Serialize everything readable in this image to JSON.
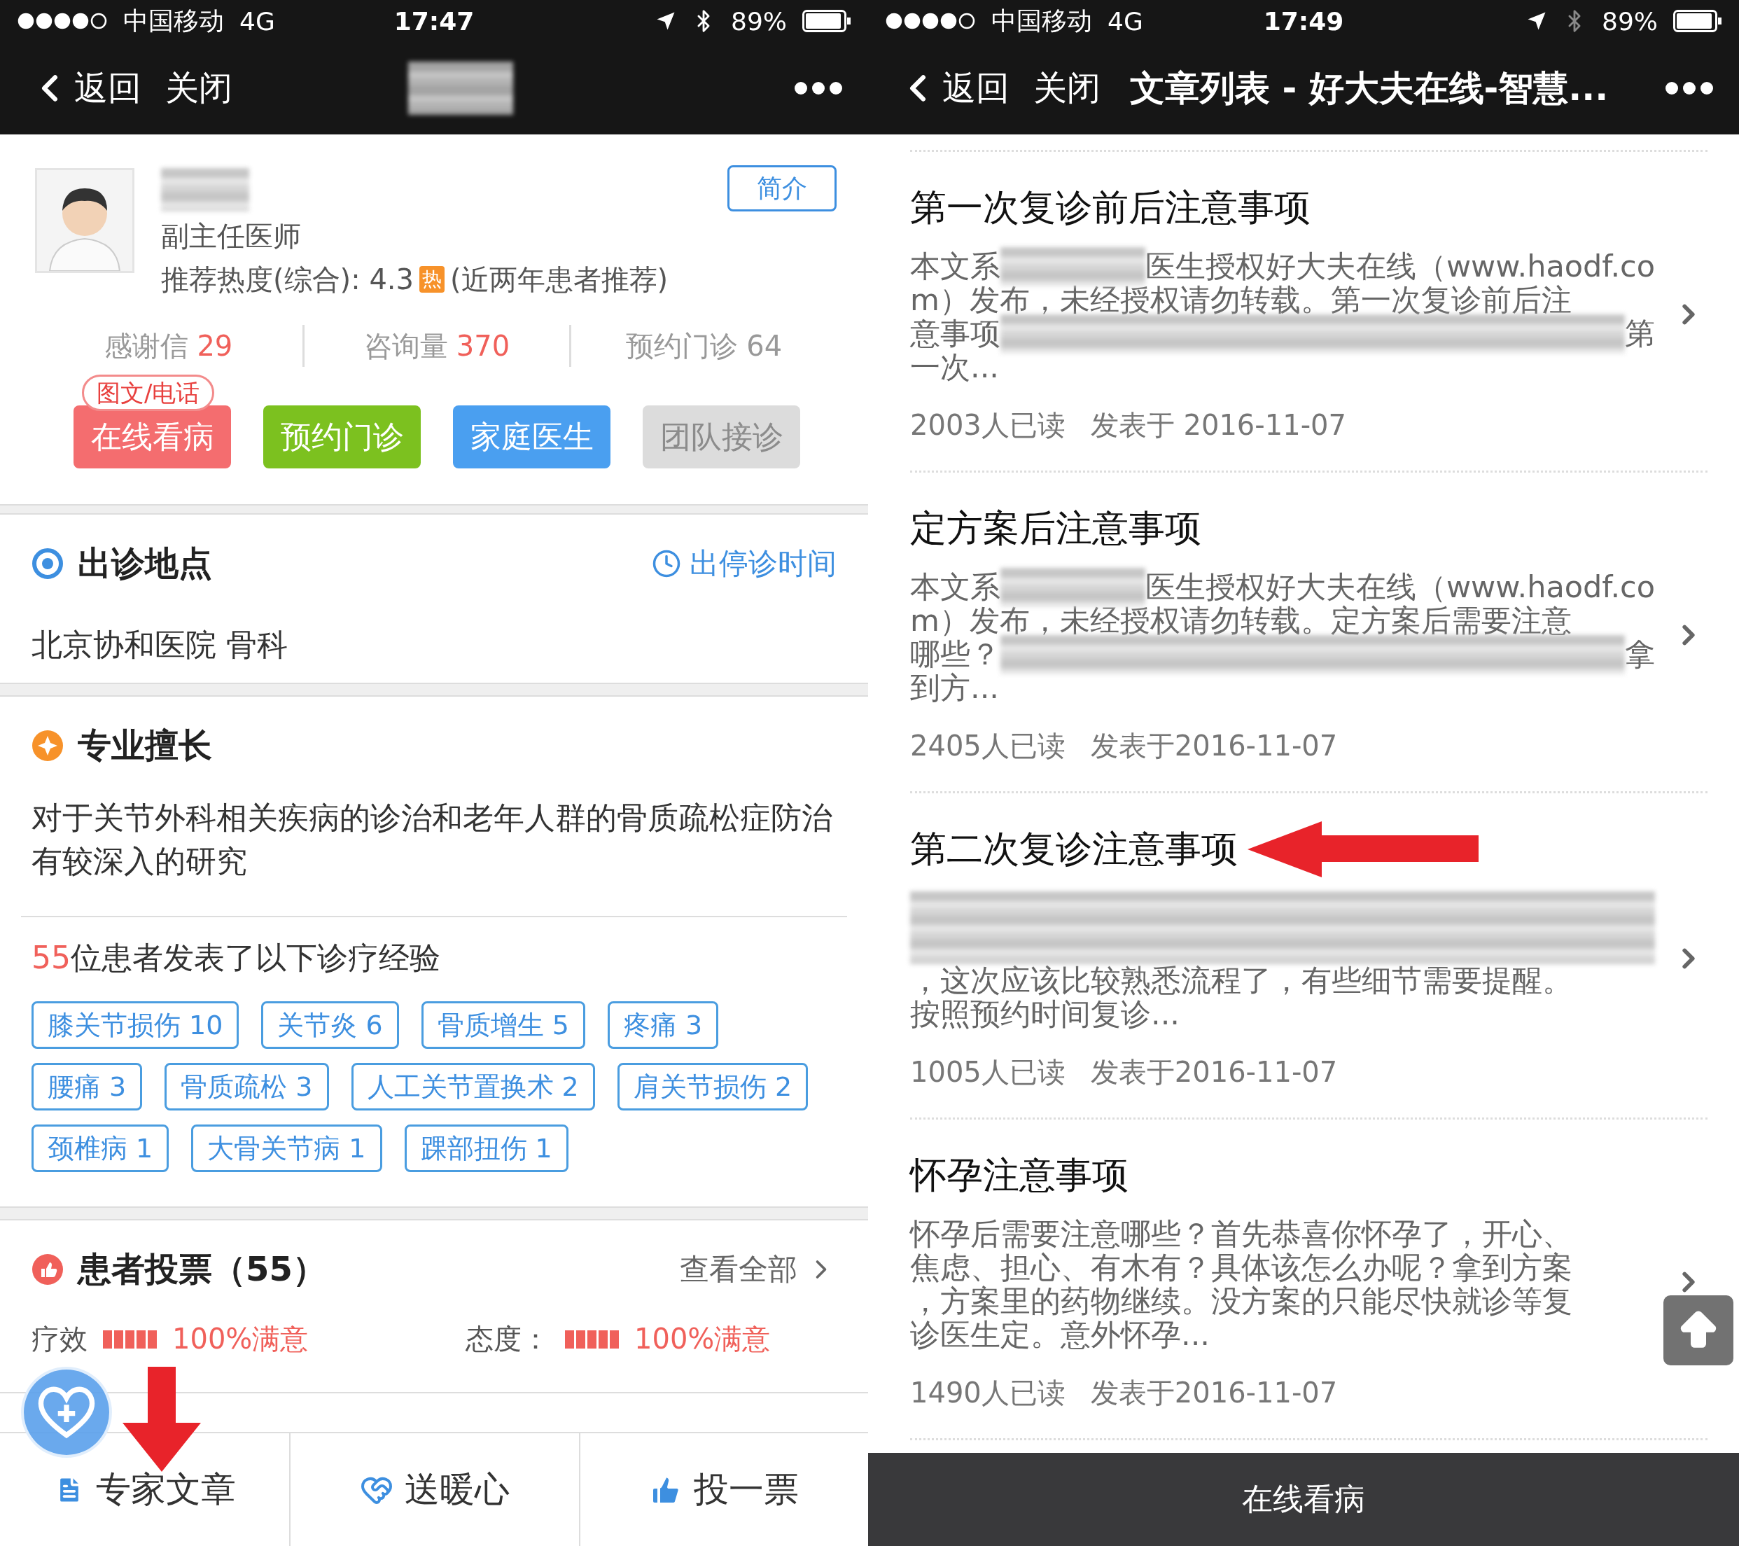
{
  "left_screen": {
    "status_bar": {
      "carrier": "中国移动",
      "network": "4G",
      "time": "17:47",
      "battery": "89%"
    },
    "nav": {
      "back": "返回",
      "close": "关闭"
    },
    "doctor": {
      "title": "副主任医师",
      "rating": "推荐热度(综合): 4.3",
      "hot_badge": "热",
      "rating_note": "(近两年患者推荐)",
      "intro_button": "简介"
    },
    "stats": [
      {
        "label": "感谢信",
        "value": "29",
        "highlight": true
      },
      {
        "label": "咨询量",
        "value": "370",
        "highlight": true
      },
      {
        "label": "预约门诊",
        "value": "64",
        "highlight": false
      }
    ],
    "services": [
      {
        "label": "在线看病",
        "color": "#f46d6f",
        "disabled": false,
        "badge": "图文/电话"
      },
      {
        "label": "预约门诊",
        "color": "#7cc11f",
        "disabled": false
      },
      {
        "label": "家庭医生",
        "color": "#4a9ff0",
        "disabled": false
      },
      {
        "label": "团队接诊",
        "color": "#dcdcdc",
        "disabled": true
      }
    ],
    "location": {
      "heading": "出诊地点",
      "schedule_link": "出停诊时间",
      "address": "北京协和医院 骨科"
    },
    "expertise": {
      "heading": "专业擅长",
      "text": "对于关节外科相关疾病的诊治和老年人群的骨质疏松症防治有较深入的研究"
    },
    "experience": {
      "count": "55",
      "text": "位患者发表了以下诊疗经验",
      "tags": [
        "膝关节损伤 10",
        "关节炎 6",
        "骨质增生 5",
        "疼痛 3",
        "腰痛 3",
        "骨质疏松 3",
        "人工关节置换术 2",
        "肩关节损伤 2",
        "颈椎病 1",
        "大骨关节病 1",
        "踝部扭伤 1"
      ]
    },
    "votes": {
      "heading": "患者投票（55）",
      "view_all": "查看全部",
      "ratings": [
        {
          "label": "疗效",
          "stars": 5,
          "value": "100%满意"
        },
        {
          "label": "态度：",
          "stars": 5,
          "value": "100%满意"
        }
      ]
    },
    "tabs": [
      {
        "label": "专家文章",
        "marked": true
      },
      {
        "label": "送暖心",
        "marked": false
      },
      {
        "label": "投一票",
        "marked": false
      }
    ]
  },
  "right_screen": {
    "status_bar": {
      "carrier": "中国移动",
      "network": "4G",
      "time": "17:49",
      "battery": "89%"
    },
    "nav": {
      "back": "返回",
      "close": "关闭",
      "title": "文章列表 - 好大夫在线-智慧..."
    },
    "articles": [
      {
        "title": "第一次复诊前后注意事项",
        "marked": false,
        "lines": [
          [
            {
              "kind": "text",
              "text": "本文系"
            },
            {
              "kind": "blur"
            },
            {
              "kind": "text",
              "text": "医生授权好大夫在线（www.haodf.co"
            }
          ],
          [
            {
              "kind": "text",
              "text": "m）发布，未经授权请勿转载。第一次复诊前后注"
            }
          ],
          [
            {
              "kind": "text",
              "text": "意事项"
            },
            {
              "kind": "blur"
            },
            {
              "kind": "text",
              "text": "第"
            }
          ],
          [
            {
              "kind": "text",
              "text": "一次..."
            }
          ]
        ],
        "reads": "2003人已读",
        "date": "发表于 2016-11-07"
      },
      {
        "title": "定方案后注意事项",
        "marked": false,
        "lines": [
          [
            {
              "kind": "text",
              "text": "本文系"
            },
            {
              "kind": "blur"
            },
            {
              "kind": "text",
              "text": "医生授权好大夫在线（www.haodf.co"
            }
          ],
          [
            {
              "kind": "text",
              "text": "m）发布，未经授权请勿转载。定方案后需要注意"
            }
          ],
          [
            {
              "kind": "text",
              "text": "哪些？"
            },
            {
              "kind": "blur"
            },
            {
              "kind": "text",
              "text": "拿"
            }
          ],
          [
            {
              "kind": "text",
              "text": "到方..."
            }
          ]
        ],
        "reads": "2405人已读",
        "date": "发表于2016-11-07"
      },
      {
        "title": "第二次复诊注意事项",
        "marked": true,
        "lines": [
          [
            {
              "kind": "blurblock"
            }
          ],
          [
            {
              "kind": "text",
              "text": "，这次应该比较熟悉流程了，有些细节需要提醒。"
            }
          ],
          [
            {
              "kind": "text",
              "text": "按照预约时间复诊..."
            }
          ]
        ],
        "reads": "1005人已读",
        "date": "发表于2016-11-07"
      },
      {
        "title": "怀孕注意事项",
        "marked": false,
        "lines": [
          [
            {
              "kind": "text",
              "text": "怀孕后需要注意哪些？首先恭喜你怀孕了，开心、"
            }
          ],
          [
            {
              "kind": "text",
              "text": "焦虑、担心、有木有？具体该怎么办呢？拿到方案"
            }
          ],
          [
            {
              "kind": "text",
              "text": "，方案里的药物继续。没方案的只能尽快就诊等复"
            }
          ],
          [
            {
              "kind": "text",
              "text": "诊医生定。意外怀孕..."
            }
          ]
        ],
        "reads": "1490人已读",
        "date": "发表于2016-11-07"
      }
    ],
    "bottom_bar": "在线看病"
  }
}
